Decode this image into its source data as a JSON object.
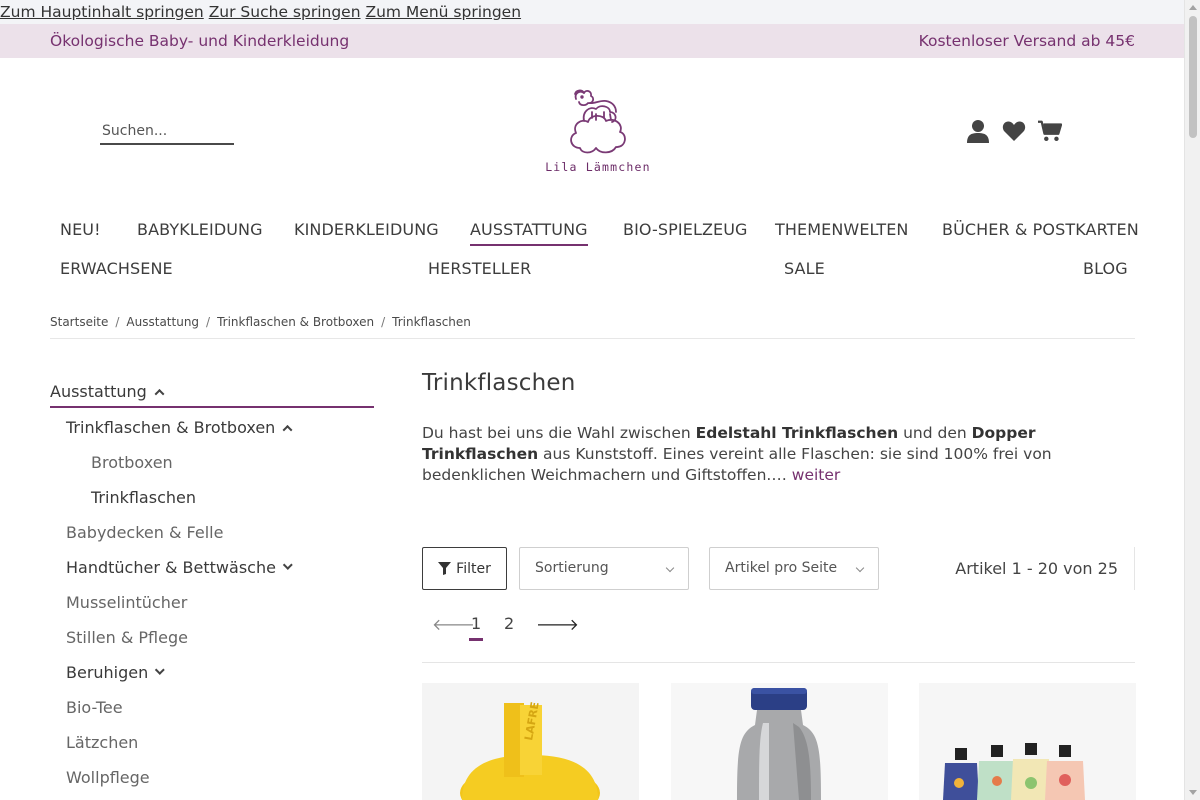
{
  "skip_links": [
    "Zum Hauptinhalt springen",
    "Zur Suche springen",
    "Zum Menü springen"
  ],
  "topbar": {
    "left": "Ökologische Baby- und Kinderkleidung",
    "right": "Kostenloser Versand ab 45€"
  },
  "search": {
    "placeholder": "Suchen..."
  },
  "logo": {
    "brand": "Lila Lämmchen"
  },
  "header_icons": [
    "user-icon",
    "heart-icon",
    "cart-icon"
  ],
  "nav": {
    "row1": [
      "NEU!",
      "BABYKLEIDUNG",
      "KINDERKLEIDUNG",
      "AUSSTATTUNG",
      "BIO-SPIELZEUG",
      "THEMENWELTEN",
      "BÜCHER & POSTKARTEN"
    ],
    "row2": [
      "ERWACHSENE",
      "HERSTELLER",
      "SALE",
      "BLOG"
    ],
    "active": "AUSSTATTUNG"
  },
  "breadcrumb": [
    "Startseite",
    "Ausstattung",
    "Trinkflaschen & Brotboxen",
    "Trinkflaschen"
  ],
  "sidebar": {
    "heading": "Ausstattung",
    "items": [
      "Trinkflaschen & Brotboxen",
      "Brotboxen",
      "Trinkflaschen",
      "Babydecken & Felle",
      "Handtücher & Bettwäsche",
      "Musselintücher",
      "Stillen & Pflege",
      "Beruhigen",
      "Bio-Tee",
      "Lätzchen",
      "Wollpflege"
    ]
  },
  "page": {
    "title": "Trinkflaschen",
    "desc_1": "Du hast bei uns die Wahl zwischen ",
    "desc_b1": "Edelstahl Trinkflaschen",
    "desc_2": " und den ",
    "desc_b2": "Dopper Trinkflaschen",
    "desc_3": " aus Kunststoff. Eines vereint alle Flaschen: sie sind 100% frei von bedenklichen Weichmachern und Giftstoffen.… ",
    "desc_more": "weiter"
  },
  "toolbar": {
    "filter": "Filter",
    "sort": "Sortierung",
    "per_page": "Artikel pro Seite",
    "count": "Artikel 1 - 20 von 25"
  },
  "pagination": {
    "prev": "🡐",
    "pages": [
      "1",
      "2"
    ],
    "next": "🡒",
    "current": "1"
  },
  "product_labels": [
    "LAFRE"
  ],
  "colors": {
    "accent": "#76316f",
    "topbar_bg": "#ece1ea"
  }
}
